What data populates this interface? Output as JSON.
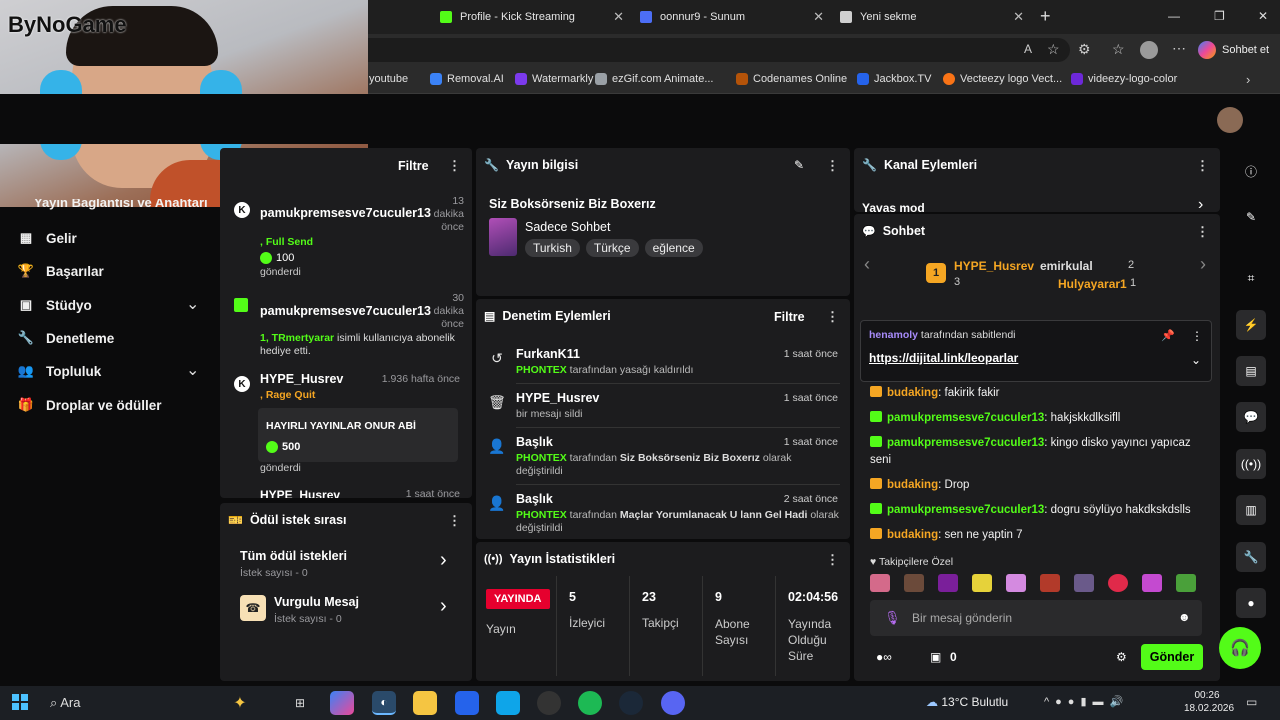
{
  "watermark": "ByNoGame",
  "browser": {
    "tabs": [
      {
        "label": "Profile - Kick Streaming",
        "color": "#53fc18"
      },
      {
        "label": "oonnur9 - Sunum",
        "color": "#4c6ef5"
      },
      {
        "label": "Yeni sekme",
        "color": "#cfcfcf"
      }
    ],
    "new_tab": "+",
    "window_controls": [
      "—",
      "❐",
      "✕"
    ],
    "copilot_label": "Sohbet et",
    "bookmarks": [
      {
        "label": "youtube",
        "color": "#ff0000"
      },
      {
        "label": "Removal.AI",
        "color": "#3b82f6"
      },
      {
        "label": "Watermarkly",
        "color": "#7c3aed"
      },
      {
        "label": "ezGif.com Animate...",
        "color": "#9aa0a6"
      },
      {
        "label": "Codenames Online",
        "color": "#b45309"
      },
      {
        "label": "Jackbox.TV",
        "color": "#2563eb"
      },
      {
        "label": "Vecteezy logo Vect...",
        "color": "#f97316"
      },
      {
        "label": "videezy-logo-color",
        "color": "#6d28d9"
      }
    ]
  },
  "sidebar": {
    "partial_item": "Yayın Bağlantısı ve Anahtarı",
    "items": [
      {
        "label": "Gelir",
        "icon": "money-icon",
        "glyph": "▦"
      },
      {
        "label": "Başarılar",
        "icon": "trophy-icon",
        "glyph": "🏆"
      },
      {
        "label": "Stüdyo",
        "icon": "studio-icon",
        "glyph": "▣",
        "expand": "⌄"
      },
      {
        "label": "Denetleme",
        "icon": "wrench-icon",
        "glyph": "🔧"
      },
      {
        "label": "Topluluk",
        "icon": "community-icon",
        "glyph": "👥",
        "expand": "⌄"
      },
      {
        "label": "Droplar ve ödüller",
        "icon": "gift-icon",
        "glyph": "🎁"
      }
    ]
  },
  "events": {
    "filter_label": "Filtre",
    "items": [
      {
        "user": "pamukpremsesve7cuculer13",
        "time": "13 dakika önce",
        "detail_a": ", Full Send",
        "amount": "100",
        "sent": "gönderdi"
      },
      {
        "user": "pamukpremsesve7cuculer13",
        "time": "30 dakika önce",
        "detail_a": "1, TRmertyarar",
        "detail_b": " isimli kullanıcıya abonelik hediye etti."
      },
      {
        "user": "HYPE_Husrev",
        "time": "1.936 hafta önce",
        "detail_a": ", Rage Quit",
        "message": "HAYIRLI YAYINLAR ONUR ABİ",
        "amount": "500",
        "sent": "gönderdi"
      }
    ],
    "cut_user": "HYPE_Husrev",
    "cut_time": "1 saat önce"
  },
  "rewards": {
    "title": "Ödül istek sırası",
    "items": [
      {
        "title": "Tüm ödül istekleri",
        "sub": "İstek sayısı - 0"
      },
      {
        "title": "Vurgulu Mesaj",
        "sub": "İstek sayısı - 0"
      }
    ]
  },
  "stream_info": {
    "title": "Yayın bilgisi",
    "stream_title": "Siz Boksörseniz Biz Boxerız",
    "category": "Sadece Sohbet",
    "tags": [
      "Turkish",
      "Türkçe",
      "eğlence"
    ]
  },
  "moderation": {
    "title": "Denetim Eylemleri",
    "filter_label": "Filtre",
    "items": [
      {
        "title": "FurkanK11",
        "actor": "PHONTEX",
        "text": " tarafından yasağı kaldırıldı",
        "time": "1 saat önce",
        "icon": "unban-icon",
        "glyph": "↺"
      },
      {
        "title": "HYPE_Husrev",
        "actor": "",
        "text": "bir mesajı sildi",
        "time": "1 saat önce",
        "icon": "trash-icon",
        "glyph": "🗑"
      },
      {
        "title": "Başlık",
        "actor": "PHONTEX",
        "text": " tarafından ",
        "bold": "Siz Boksörseniz Biz Boxerız",
        "suffix": " olarak değiştirildi",
        "time": "1 saat önce",
        "icon": "user-edit-icon",
        "glyph": "👤"
      },
      {
        "title": "Başlık",
        "actor": "PHONTEX",
        "text": " tarafından ",
        "bold": "Maçlar Yorumlanacak U lann Gel Hadi",
        "suffix": " olarak değiştirildi",
        "time": "2 saat önce",
        "icon": "user-edit-icon",
        "glyph": "👤"
      }
    ]
  },
  "stats": {
    "title": "Yayın İstatistikleri",
    "live_badge": "YAYINDA",
    "live_label": "Yayın",
    "items": [
      {
        "value": "5",
        "label": "İzleyici"
      },
      {
        "value": "23",
        "label": "Takipçi"
      },
      {
        "value": "9",
        "label": "Abone Sayısı"
      },
      {
        "value": "02:04:56",
        "label": "Yayında Olduğu Süre"
      }
    ]
  },
  "channel_actions": {
    "title": "Kanal Eylemleri",
    "item": "Yavaş mod"
  },
  "chat": {
    "title": "Sohbet",
    "leaderboard": [
      {
        "rank": "1",
        "user": "HYPE_Husrev",
        "count": "3"
      },
      {
        "user": "emirkulal",
        "count": "2"
      },
      {
        "user": "Hulyayarar1",
        "count": "1"
      }
    ],
    "pinned_by": "henamoly",
    "pinned_suffix": " tarafından sabitlendi",
    "pinned_link": "https://dijital.link/leoparlar",
    "messages": [
      {
        "user": "budaking",
        "text": " fakirik fakir",
        "color": "#f5a623"
      },
      {
        "user": "pamukpremsesve7cuculer13",
        "text": " hakjskkdlksifll",
        "color": "#53fc18"
      },
      {
        "user": "pamukpremsesve7cuculer13",
        "text": " kingo disko yayıncı yapıcaz seni",
        "color": "#53fc18"
      },
      {
        "user": "budaking",
        "text": " Drop",
        "color": "#f5a623"
      },
      {
        "user": "pamukpremsesve7cuculer13",
        "text": " dogru söylüyo hakdkskdslls",
        "color": "#53fc18"
      },
      {
        "user": "budaking",
        "text": " sen ne yaptin 7",
        "color": "#f5a623"
      }
    ],
    "emote_section": "Takipçilere Özel",
    "input_placeholder": "Bir mesaj gönderin",
    "points": "0",
    "send_label": "Gönder"
  },
  "taskbar": {
    "search": "Ara",
    "weather": "13°C  Bulutlu",
    "time": "00:26",
    "date": "18.02.2026"
  }
}
